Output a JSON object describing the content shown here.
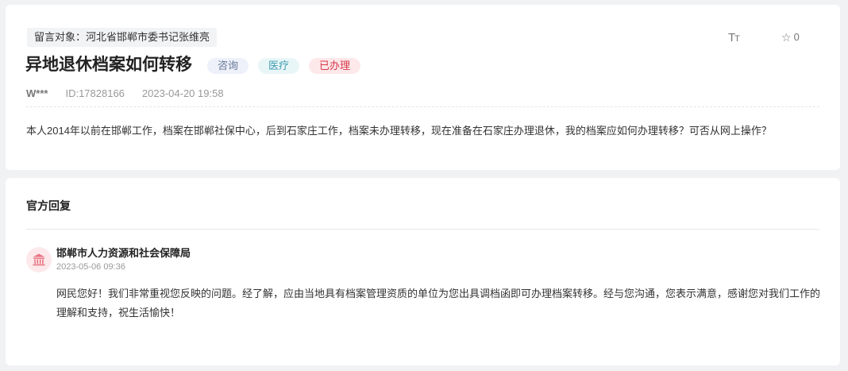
{
  "message": {
    "target_label": "留言对象：河北省邯郸市委书记张维亮",
    "title": "异地退休档案如何转移",
    "tags": [
      {
        "label": "咨询",
        "color": "#68789a"
      },
      {
        "label": "医疗",
        "color": "#3c9bb0"
      },
      {
        "label": "已办理",
        "color": "#d8384a"
      }
    ],
    "font_toggle": {
      "big": "T",
      "small": "T"
    },
    "favorite_count": "0",
    "author": "W***",
    "id_text": "ID:17828166",
    "datetime": "2023-04-20 19:58",
    "content": "本人2014年以前在邯郸工作，档案在邯郸社保中心，后到石家庄工作，档案未办理转移，现在准备在石家庄办理退休，我的档案应如何办理转移？可否从网上操作？"
  },
  "reply": {
    "heading": "官方回复",
    "org_name": "邯郸市人力资源和社会保障局",
    "datetime": "2023-05-06 09:36",
    "content": "网民您好！我们非常重视您反映的问题。经了解，应由当地具有档案管理资质的单位为您出具调档函即可办理档案转移。经与您沟通，您表示满意，感谢您对我们工作的理解和支持，祝生活愉快！",
    "avatar_icon": "government-building-icon",
    "accent_color": "#e8737f"
  }
}
